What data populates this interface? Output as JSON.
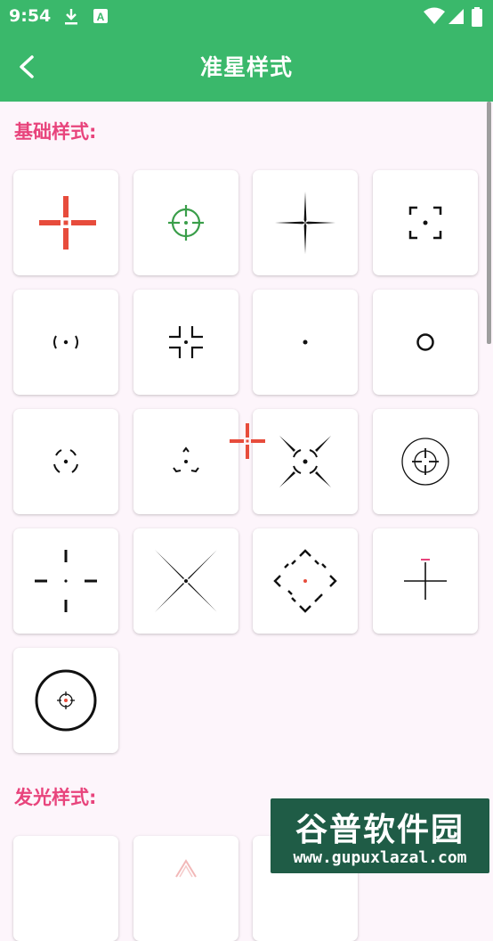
{
  "status_bar": {
    "time": "9:54",
    "icons": [
      "download-icon",
      "text-a-icon",
      "wifi-icon",
      "signal-icon",
      "battery-icon"
    ]
  },
  "app_bar": {
    "title": "准星样式",
    "back_icon": "back-arrow-icon"
  },
  "sections": {
    "basic": {
      "title": "基础样式:"
    },
    "glow": {
      "title": "发光样式:"
    }
  },
  "styles": [
    "red-cross",
    "green-scope",
    "thin-cross",
    "corner-box",
    "parenthesis-dot",
    "four-corners",
    "center-dot",
    "ring",
    "dashed-circle",
    "triangle-dots",
    "x-ring",
    "scope-circle",
    "dashed-cross",
    "diagonal-x",
    "diamond-dashes",
    "pink-cross",
    "big-ring-target"
  ],
  "watermark": {
    "name": "谷普软件园",
    "url": "www.gupuxlazal.com"
  },
  "colors": {
    "bar": "#3ab86b",
    "section_title": "#e8447c",
    "background": "#fdf5fb",
    "accent_red": "#e74c3c",
    "accent_green": "#3a9e4a"
  }
}
